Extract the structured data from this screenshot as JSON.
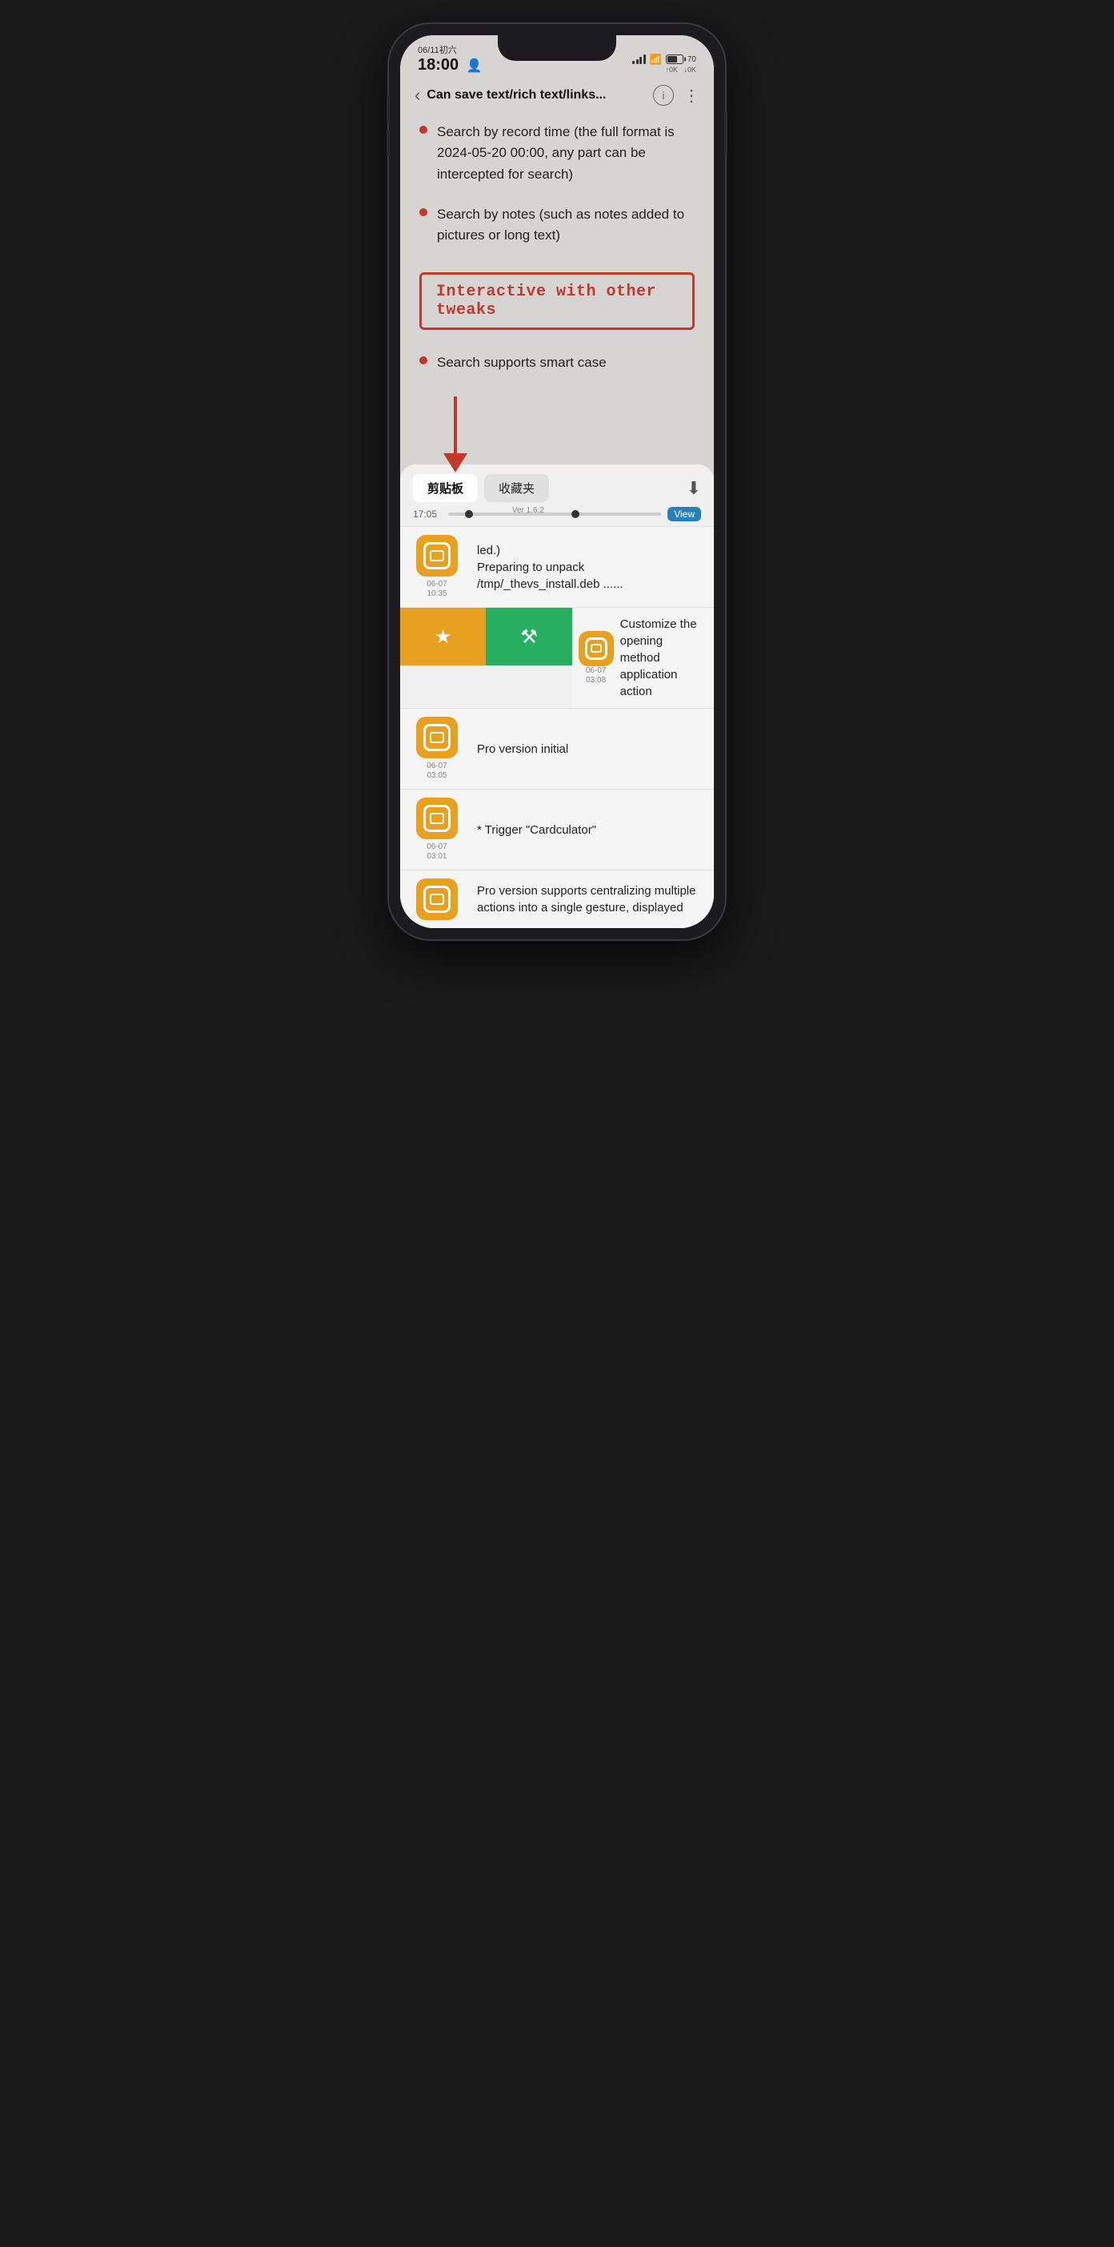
{
  "phone": {
    "status": {
      "date": "06/11初六",
      "time": "18:00",
      "user_icon": "👤",
      "network_up": "↑0K",
      "network_down": "↓0K",
      "battery_level": "70"
    },
    "nav": {
      "back_label": "‹",
      "title": "Can save text/rich text/links...",
      "info_label": "ⓘ",
      "more_label": "⋮"
    },
    "content": {
      "bullet1": "Search by record time (the full format is 2024-05-20 00:00, any part can be intercepted for search)",
      "bullet2": "Search by notes (such as notes added to pictures or long text)",
      "interactive_label": "Interactive with other tweaks",
      "bullet3": "Search supports smart case"
    },
    "bottom_panel": {
      "tabs": [
        {
          "label": "剪贴板",
          "active": true
        },
        {
          "label": "收藏夹",
          "active": false
        }
      ],
      "download_icon": "⬇",
      "timeline": {
        "time": "17:05",
        "ver_label": "Ver 1.6.2",
        "view_label": "View"
      },
      "list_items": [
        {
          "id": "item1",
          "date": "06-07\n10:35",
          "text": "led.)\nPreparing to unpack /tmp/_thevs_install.deb ......"
        },
        {
          "id": "item2",
          "date": "06-07\n03:08",
          "text": "Customize the opening method application action",
          "swipe_actions": [
            {
              "label": "★",
              "color": "yellow"
            },
            {
              "label": "⚒",
              "color": "green"
            }
          ]
        },
        {
          "id": "item3",
          "date": "06-07\n03:05",
          "text": "Pro version initial"
        },
        {
          "id": "item4",
          "date": "06-07\n03:01",
          "text": "* Trigger \"Cardculator\""
        },
        {
          "id": "item5",
          "date": "",
          "text": "Pro version supports centralizing multiple actions into a single gesture, displayed"
        }
      ]
    }
  }
}
